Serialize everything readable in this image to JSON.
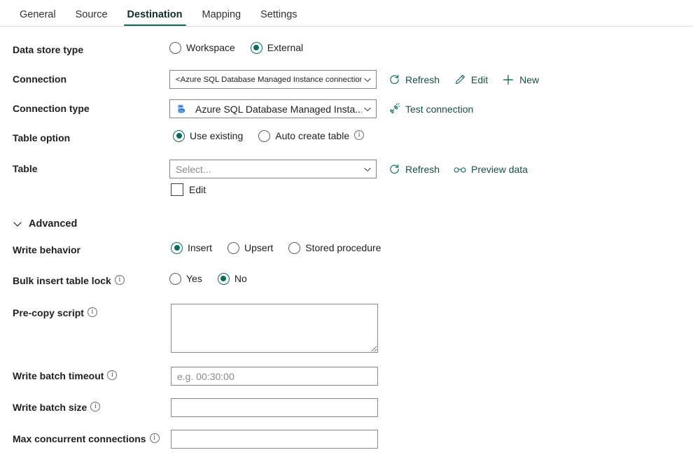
{
  "tabs": [
    {
      "label": "General",
      "active": false
    },
    {
      "label": "Source",
      "active": false
    },
    {
      "label": "Destination",
      "active": true
    },
    {
      "label": "Mapping",
      "active": false
    },
    {
      "label": "Settings",
      "active": false
    }
  ],
  "accent_color": "#0f6b60",
  "link_color": "#1b6f66",
  "form": {
    "data_store_type": {
      "label": "Data store type",
      "options": [
        "Workspace",
        "External"
      ],
      "selected": "External"
    },
    "connection": {
      "label": "Connection",
      "value": "<Azure SQL Database Managed Instance connection>",
      "actions": [
        {
          "label": "Refresh",
          "icon": "refresh-icon"
        },
        {
          "label": "Edit",
          "icon": "pencil-icon"
        },
        {
          "label": "New",
          "icon": "plus-icon"
        }
      ]
    },
    "connection_type": {
      "label": "Connection type",
      "value": "Azure SQL Database Managed Insta...",
      "icon": "azure-sql-managed-instance-icon",
      "action": {
        "label": "Test connection",
        "icon": "plug-icon"
      }
    },
    "table_option": {
      "label": "Table option",
      "options": [
        "Use existing",
        "Auto create table"
      ],
      "selected": "Use existing",
      "info_on": "Auto create table"
    },
    "table": {
      "label": "Table",
      "placeholder": "Select...",
      "value": "",
      "edit_checkbox_label": "Edit",
      "edit_checked": false,
      "actions": [
        {
          "label": "Refresh",
          "icon": "refresh-icon"
        },
        {
          "label": "Preview data",
          "icon": "glasses-icon"
        }
      ]
    },
    "advanced": {
      "label": "Advanced",
      "expanded": true
    },
    "write_behavior": {
      "label": "Write behavior",
      "options": [
        "Insert",
        "Upsert",
        "Stored procedure"
      ],
      "selected": "Insert"
    },
    "bulk_insert_table_lock": {
      "label": "Bulk insert table lock",
      "options": [
        "Yes",
        "No"
      ],
      "selected": "No"
    },
    "pre_copy_script": {
      "label": "Pre-copy script",
      "value": "",
      "placeholder": ""
    },
    "write_batch_timeout": {
      "label": "Write batch timeout",
      "value": "",
      "placeholder": "e.g. 00:30:00"
    },
    "write_batch_size": {
      "label": "Write batch size",
      "value": "",
      "placeholder": ""
    },
    "max_concurrent_connections": {
      "label": "Max concurrent connections",
      "value": "",
      "placeholder": ""
    }
  }
}
